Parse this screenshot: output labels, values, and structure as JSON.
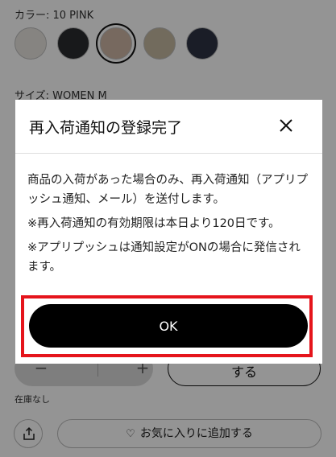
{
  "product": {
    "color_label": "カラー: 10 PINK",
    "swatches": [
      {
        "name": "white",
        "color": "#e7e4de"
      },
      {
        "name": "black",
        "color": "#2a2c30"
      },
      {
        "name": "pink",
        "color": "#cdb6a4"
      },
      {
        "name": "beige",
        "color": "#c4b8a0"
      },
      {
        "name": "navy",
        "color": "#2e3344"
      }
    ],
    "selected_swatch": "pink",
    "size_label": "サイズ: WOMEN M",
    "stepper": {
      "minus": "−",
      "plus": "+"
    },
    "notify_button_label": "する",
    "stock_status": "在庫なし",
    "favorite_button_label": "お気に入りに追加する"
  },
  "dialog": {
    "title": "再入荷通知の登録完了",
    "body": [
      "商品の入荷があった場合のみ、再入荷通知（アプリプッシュ通知、メール）を送付します。",
      "※再入荷通知の有効期限は本日より120日です。",
      "※アプリプッシュは通知設定がONの場合に発信されます。"
    ],
    "ok_label": "OK"
  },
  "highlight_color": "#e5141b"
}
